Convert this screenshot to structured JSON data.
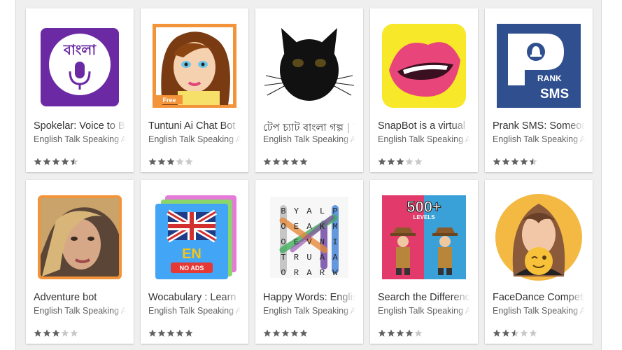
{
  "apps": [
    {
      "title": "Spokelar: Voice to Bangla",
      "developer": "English Talk Speaking App",
      "rating": 4.5,
      "icon": "bangla-mic-icon",
      "badge": "বাংলা",
      "accent": "#6b2aa3"
    },
    {
      "title": "Tuntuni Ai Chat Bot",
      "developer": "English Talk Speaking App",
      "rating": 3,
      "icon": "cartoon-girl-icon",
      "badge": "Free",
      "accent": "#f3933a"
    },
    {
      "title": "টেপ চ্যাট বাংলা গল্প | Tap Chat",
      "developer": "English Talk Speaking App",
      "rating": 5,
      "icon": "black-cat-icon",
      "accent": "#111111"
    },
    {
      "title": "SnapBot is a virtual",
      "developer": "English Talk Speaking App",
      "rating": 3,
      "icon": "lips-icon",
      "accent": "#f7e82a"
    },
    {
      "title": "Prank SMS: Someone",
      "developer": "English Talk Speaking App",
      "rating": 4.5,
      "icon": "prank-sms-icon",
      "brand_top": "RANK",
      "brand_bottom": "SMS",
      "accent": "#2f4f8f"
    },
    {
      "title": "Adventure bot",
      "developer": "English Talk Speaking App",
      "rating": 3,
      "icon": "woman-portrait-icon",
      "accent": "#f3933a"
    },
    {
      "title": "Wocabulary : Learn",
      "developer": "English Talk Speaking App",
      "rating": 5,
      "icon": "uk-flag-book-icon",
      "badge": "EN",
      "badge2": "NO ADS",
      "accent": "#42a5f5"
    },
    {
      "title": "Happy Words: English",
      "developer": "English Talk Speaking App",
      "rating": 5,
      "icon": "word-search-icon",
      "letters": [
        "B",
        "Y",
        "A",
        "L",
        "P",
        "O",
        "E",
        "A",
        "K",
        "M",
        "O",
        "E",
        "V",
        "N",
        "I",
        "T",
        "R",
        "U",
        "A",
        "A",
        "O",
        "R",
        "A",
        "R",
        "W"
      ],
      "accent": "#f5f5f5"
    },
    {
      "title": "Search the Differences",
      "developer": "English Talk Speaking App",
      "rating": 4,
      "icon": "detectives-icon",
      "badge": "500+",
      "badge2": "LEVELS",
      "accent": "#e23b6b"
    },
    {
      "title": "FaceDance Competition",
      "developer": "English Talk Speaking App",
      "rating": 2.5,
      "icon": "winking-girl-icon",
      "accent": "#f4b942"
    }
  ]
}
